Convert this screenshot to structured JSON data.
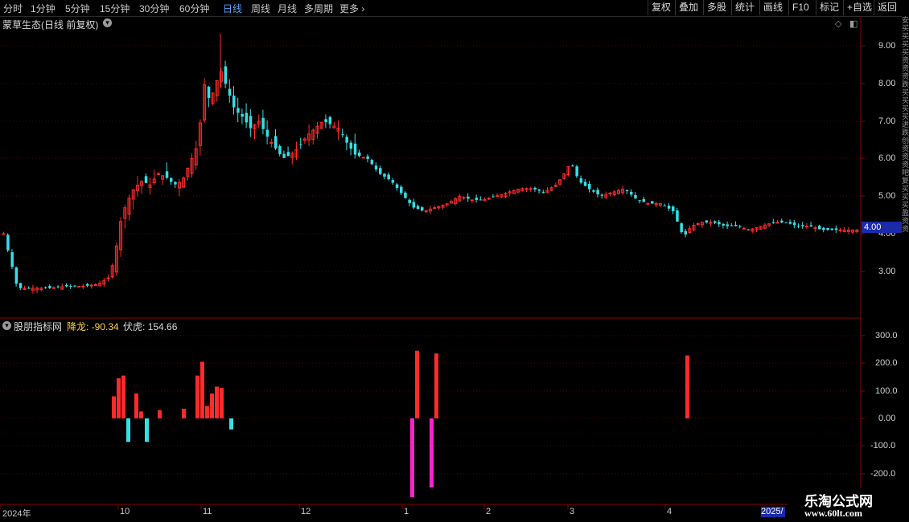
{
  "toolbar": {
    "periods": [
      "分时",
      "1分钟",
      "5分钟",
      "15分钟",
      "30分钟",
      "60分钟",
      "日线",
      "周线",
      "月线",
      "多周期",
      "更多"
    ],
    "active_period": "日线",
    "right_buttons": [
      "复权",
      "叠加",
      "多股",
      "统计",
      "画线",
      "F10",
      "标记",
      "+自选",
      "返回"
    ]
  },
  "main": {
    "title": "蒙草生态(日线 前复权)",
    "price_axis_labels": [
      "9.00",
      "8.00",
      "7.00",
      "6.00",
      "5.00",
      "4.00",
      "3.00"
    ],
    "current_price": "4.00"
  },
  "indicator": {
    "name": "股朋指标网",
    "line1_label": "降龙",
    "line1_value": "-90.34",
    "line2_label": "伏虎",
    "line2_value": "154.66",
    "axis_labels": [
      "300.0",
      "200.0",
      "100.0",
      "0.00",
      "-100.0",
      "-200.0"
    ]
  },
  "xaxis": {
    "labels": [
      "2024年",
      "10",
      "11",
      "12",
      "1",
      "2",
      "3",
      "4"
    ],
    "year_badge": "2025/"
  },
  "watermark": {
    "title": "乐淘公式网",
    "url": "www.60lt.com"
  },
  "colors": {
    "up": "#ff2a2a",
    "down": "#33e0e8",
    "magenta": "#ff22cc",
    "grid": "#5a0000",
    "axis": "#8b0000",
    "active": "#5aa0ff"
  },
  "right_strip": [
    "安",
    "买",
    "买",
    "买",
    "买",
    "资",
    "资",
    "资",
    "跌",
    "买",
    "买",
    "买",
    "买",
    "进",
    "跌",
    "创",
    "资",
    "资",
    "资",
    "吧",
    "复",
    "买",
    "买",
    "买",
    "盈",
    "资",
    "资"
  ]
}
